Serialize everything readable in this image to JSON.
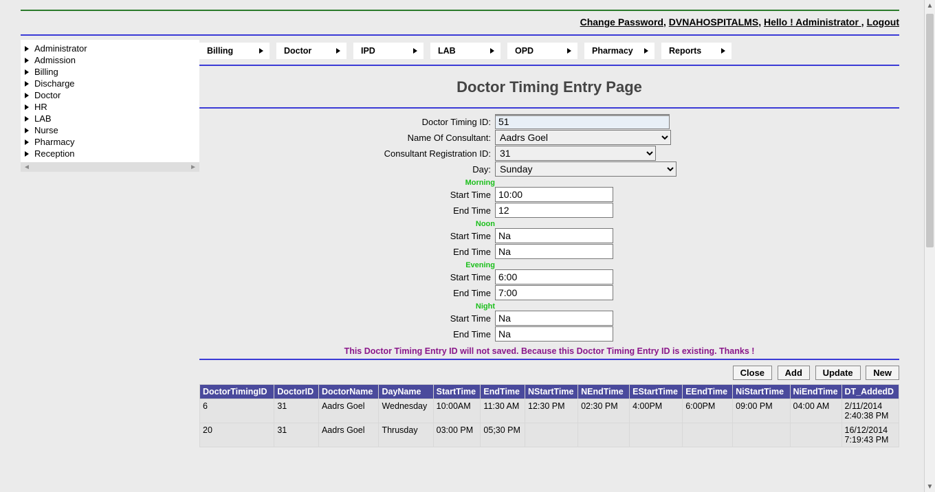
{
  "topLinks": {
    "changePassword": "Change Password",
    "brand": "DVNAHOSPITALMS",
    "greeting": "Hello ! Administrator ",
    "logout": "Logout"
  },
  "sidebar": {
    "items": [
      "Administrator",
      "Admission",
      "Billing",
      "Discharge",
      "Doctor",
      "HR",
      "LAB",
      "Nurse",
      "Pharmacy",
      "Reception"
    ]
  },
  "topMenu": [
    "Billing",
    "Doctor",
    "IPD",
    "LAB",
    "OPD",
    "Pharmacy",
    "Reports"
  ],
  "title": "Doctor Timing Entry Page",
  "form": {
    "labels": {
      "doctorTimingId": "Doctor Timing ID:",
      "consultantName": "Name Of Consultant:",
      "consultantRegId": "Consultant Registration ID:",
      "day": "Day:",
      "morning": "Morning",
      "noon": "Noon",
      "evening": "Evening",
      "night": "Night",
      "startTime": "Start Time",
      "endTime": "End Time"
    },
    "values": {
      "doctorTimingId": "51",
      "consultantName": "Aadrs Goel",
      "consultantRegId": "31",
      "day": "Sunday",
      "morningStart": "10:00",
      "morningEnd": "12",
      "noonStart": "Na",
      "noonEnd": "Na",
      "eveningStart": "6:00",
      "eveningEnd": "7:00",
      "nightStart": "Na",
      "nightEnd": "Na"
    }
  },
  "warning": "This Doctor Timing Entry ID will not saved. Because this Doctor Timing Entry ID is existing. Thanks !",
  "buttons": {
    "close": "Close",
    "add": "Add",
    "update": "Update",
    "new": "New"
  },
  "table": {
    "headers": [
      "DoctorTimingID",
      "DoctorID",
      "DoctorName",
      "DayName",
      "StartTime",
      "EndTime",
      "NStartTime",
      "NEndTime",
      "EStartTime",
      "EEndTime",
      "NiStartTime",
      "NiEndTime",
      "DT_AddedD"
    ],
    "rows": [
      {
        "c": [
          "6",
          "31",
          "Aadrs Goel",
          "Wednesday",
          "10:00AM",
          "11:30 AM",
          "12:30 PM",
          "02:30 PM",
          "4:00PM",
          "6:00PM",
          "09:00 PM",
          "04:00 AM",
          "2/11/2014 2:40:38 PM"
        ]
      },
      {
        "c": [
          "20",
          "31",
          "Aadrs Goel",
          "Thrusday",
          "03:00 PM",
          "05;30 PM",
          "",
          "",
          "",
          "",
          "",
          "",
          "16/12/2014 7:19:43 PM"
        ]
      }
    ]
  }
}
